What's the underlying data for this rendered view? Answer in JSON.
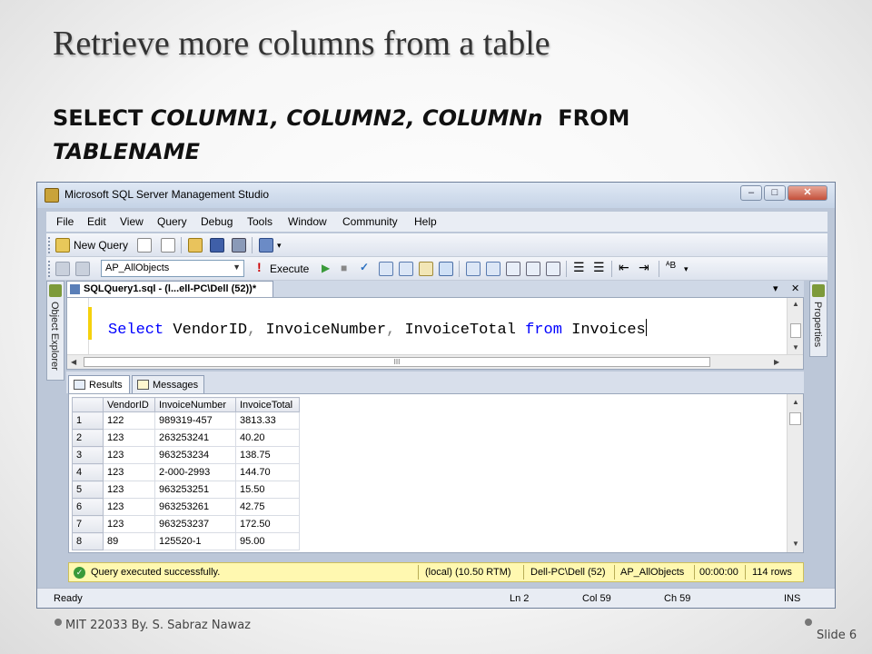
{
  "slide": {
    "title": "Retrieve more columns from a table",
    "syntax_keyword_select": "SELECT",
    "syntax_columns": "COLUMN1, COLUMN2, COLUMNn",
    "syntax_keyword_from": "FROM",
    "syntax_table": "TABLENAME",
    "footer": "MIT 22033 By. S. Sabraz Nawaz",
    "slide_number": "Slide 6"
  },
  "window": {
    "title": "Microsoft SQL Server Management Studio",
    "minimize": "–",
    "maximize": "□",
    "close": "✕"
  },
  "menu": [
    "File",
    "Edit",
    "View",
    "Query",
    "Debug",
    "Tools",
    "Window",
    "Community",
    "Help"
  ],
  "toolbar1": {
    "new_query": "New Query"
  },
  "toolbar2": {
    "database": "AP_AllObjects",
    "execute": "Execute"
  },
  "side_tabs": {
    "left": "Object Explorer",
    "right": "Properties"
  },
  "editor": {
    "tab_title": "SQLQuery1.sql - (l...ell-PC\\Dell (52))*",
    "tab_dropdown": "▾",
    "tab_close": "✕",
    "code": {
      "select": "Select",
      "col1": "VendorID",
      "comma1": ",",
      "col2": "InvoiceNumber",
      "comma2": ",",
      "col3": "InvoiceTotal",
      "from": "from",
      "table": "Invoices"
    },
    "hscroll_thumb": "III"
  },
  "results": {
    "tabs": [
      "Results",
      "Messages"
    ],
    "columns": [
      "VendorID",
      "InvoiceNumber",
      "InvoiceTotal"
    ],
    "rows": [
      {
        "n": "1",
        "vendor": "122",
        "invoice": "989319-457",
        "total": "3813.33"
      },
      {
        "n": "2",
        "vendor": "123",
        "invoice": "263253241",
        "total": "40.20"
      },
      {
        "n": "3",
        "vendor": "123",
        "invoice": "963253234",
        "total": "138.75"
      },
      {
        "n": "4",
        "vendor": "123",
        "invoice": "2-000-2993",
        "total": "144.70"
      },
      {
        "n": "5",
        "vendor": "123",
        "invoice": "963253251",
        "total": "15.50"
      },
      {
        "n": "6",
        "vendor": "123",
        "invoice": "963253261",
        "total": "42.75"
      },
      {
        "n": "7",
        "vendor": "123",
        "invoice": "963253237",
        "total": "172.50"
      },
      {
        "n": "8",
        "vendor": "89",
        "invoice": "125520-1",
        "total": "95.00"
      }
    ]
  },
  "query_status": {
    "message": "Query executed successfully.",
    "server": "(local) (10.50 RTM)",
    "user": "Dell-PC\\Dell (52)",
    "database": "AP_AllObjects",
    "elapsed": "00:00:00",
    "rows": "114 rows"
  },
  "app_status": {
    "state": "Ready",
    "line": "Ln 2",
    "col": "Col 59",
    "ch": "Ch 59",
    "mode": "INS"
  }
}
